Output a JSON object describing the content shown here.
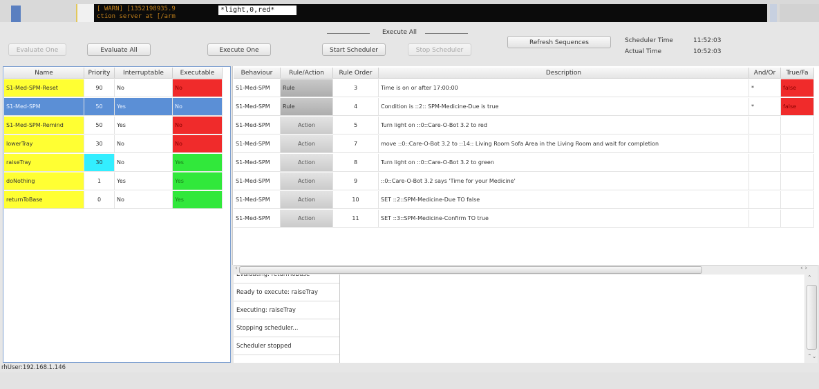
{
  "terminal": {
    "warn_text": "[ WARN] [1352198935.9\nction server at [/arm",
    "command_text": "*light,0,red*"
  },
  "toolbar": {
    "evaluate_one": "Evaluate One",
    "evaluate_all": "Evaluate All",
    "execute_one": "Execute One",
    "execute_all_group": "Execute All",
    "start_scheduler": "Start Scheduler",
    "stop_scheduler": "Stop Scheduler",
    "refresh_sequences": "Refresh Sequences",
    "scheduler_time_label": "Scheduler Time",
    "scheduler_time_value": "11:52:03",
    "actual_time_label": "Actual Time",
    "actual_time_value": "10:52:03"
  },
  "behaviours": {
    "headers": [
      "Name",
      "Priority",
      "Interruptable",
      "Executable"
    ],
    "rows": [
      {
        "name": "S1-Med-SPM-Reset",
        "priority": "90",
        "interruptable": "No",
        "executable": "No",
        "selected": false
      },
      {
        "name": "S1-Med-SPM",
        "priority": "50",
        "interruptable": "Yes",
        "executable": "No",
        "selected": true
      },
      {
        "name": "S1-Med-SPM-Remind",
        "priority": "50",
        "interruptable": "Yes",
        "executable": "No",
        "selected": false
      },
      {
        "name": "lowerTray",
        "priority": "30",
        "interruptable": "No",
        "executable": "No",
        "selected": false
      },
      {
        "name": "raiseTray",
        "priority": "30",
        "interruptable": "No",
        "executable": "Yes",
        "selected": false
      },
      {
        "name": "doNothing",
        "priority": "1",
        "interruptable": "Yes",
        "executable": "Yes",
        "selected": false
      },
      {
        "name": "returnToBase",
        "priority": "0",
        "interruptable": "No",
        "executable": "Yes",
        "selected": false
      }
    ]
  },
  "rules": {
    "headers": [
      "Behaviour",
      "Rule/Action",
      "Rule Order",
      "Description",
      "And/Or",
      "True/Fa"
    ],
    "rows": [
      {
        "behaviour": "S1-Med-SPM",
        "type": "Rule",
        "order": "3",
        "description": "Time is on or after 17:00:00",
        "andor": "*",
        "truefalse": "false"
      },
      {
        "behaviour": "S1-Med-SPM",
        "type": "Rule",
        "order": "4",
        "description": "Condition is ::2:: SPM-Medicine-Due is true",
        "andor": "*",
        "truefalse": "false"
      },
      {
        "behaviour": "S1-Med-SPM",
        "type": "Action",
        "order": "5",
        "description": "Turn light on ::0::Care-O-Bot 3.2 to  red",
        "andor": "",
        "truefalse": ""
      },
      {
        "behaviour": "S1-Med-SPM",
        "type": "Action",
        "order": "7",
        "description": "move ::0::Care-O-Bot 3.2 to ::14:: Living Room Sofa Area in the Living Room and wait for completion",
        "andor": "",
        "truefalse": ""
      },
      {
        "behaviour": "S1-Med-SPM",
        "type": "Action",
        "order": "8",
        "description": "Turn light on ::0::Care-O-Bot 3.2 to  green",
        "andor": "",
        "truefalse": ""
      },
      {
        "behaviour": "S1-Med-SPM",
        "type": "Action",
        "order": "9",
        "description": "::0::Care-O-Bot 3.2 says 'Time for your Medicine'",
        "andor": "",
        "truefalse": ""
      },
      {
        "behaviour": "S1-Med-SPM",
        "type": "Action",
        "order": "10",
        "description": "SET ::2::SPM-Medicine-Due TO  false",
        "andor": "",
        "truefalse": ""
      },
      {
        "behaviour": "S1-Med-SPM",
        "type": "Action",
        "order": "11",
        "description": "SET ::3::SPM-Medicine-Confirm TO  true",
        "andor": "",
        "truefalse": ""
      }
    ]
  },
  "log": [
    "Evaluating: returnToBase",
    "Ready to execute: raiseTray",
    "Executing: raiseTray",
    "Stopping scheduler...",
    "Scheduler stopped"
  ],
  "status": {
    "user": "rhUser:192.168.1.146"
  },
  "colors": {
    "name_yellow": "#ffff33",
    "selected_blue": "#5b8fd6",
    "no_red": "#f02b2b",
    "yes_green": "#31e83b",
    "priority_cyan": "#33eeff"
  }
}
